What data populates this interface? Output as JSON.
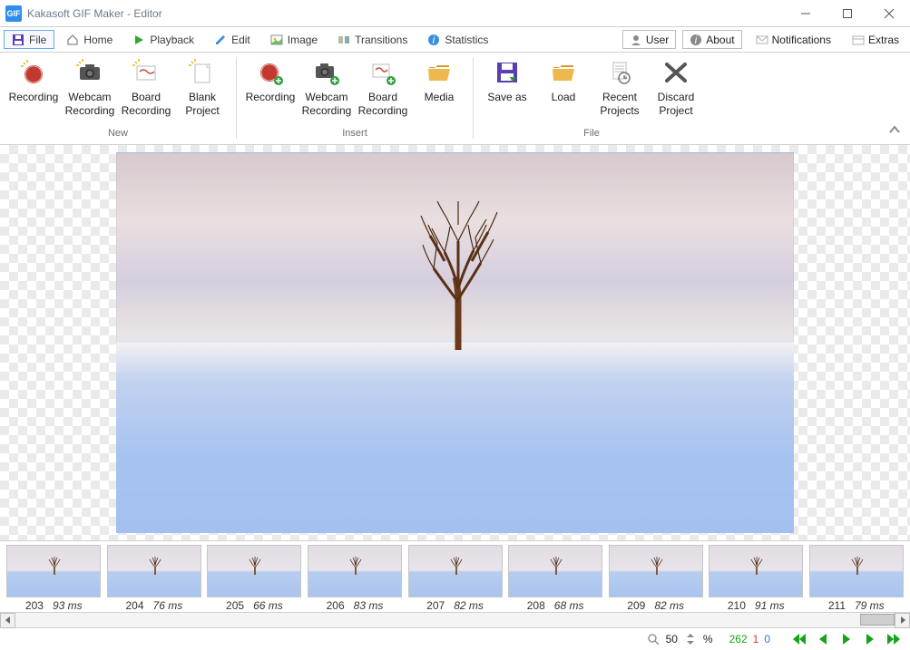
{
  "window": {
    "title": "Kakasoft GIF Maker - Editor",
    "logo": "GIF"
  },
  "tabs": {
    "file": "File",
    "home": "Home",
    "playback": "Playback",
    "edit": "Edit",
    "image": "Image",
    "transitions": "Transitions",
    "statistics": "Statistics"
  },
  "topright": {
    "user": "User",
    "about": "About",
    "notifications": "Notifications",
    "extras": "Extras"
  },
  "ribbon": {
    "groups": {
      "new": {
        "label": "New",
        "items": [
          {
            "key": "recording",
            "label": "Recording"
          },
          {
            "key": "webcam",
            "label": "Webcam\nRecording"
          },
          {
            "key": "board",
            "label": "Board\nRecording"
          },
          {
            "key": "blank",
            "label": "Blank\nProject"
          }
        ]
      },
      "insert": {
        "label": "Insert",
        "items": [
          {
            "key": "irecording",
            "label": "Recording"
          },
          {
            "key": "iwebcam",
            "label": "Webcam\nRecording"
          },
          {
            "key": "iboard",
            "label": "Board\nRecording"
          },
          {
            "key": "media",
            "label": "Media"
          }
        ]
      },
      "file": {
        "label": "File",
        "items": [
          {
            "key": "saveas",
            "label": "Save as"
          },
          {
            "key": "load",
            "label": "Load"
          },
          {
            "key": "recent",
            "label": "Recent\nProjects"
          },
          {
            "key": "discard",
            "label": "Discard\nProject"
          }
        ]
      }
    }
  },
  "frames": [
    {
      "n": "203",
      "ms": "93 ms"
    },
    {
      "n": "204",
      "ms": "76 ms"
    },
    {
      "n": "205",
      "ms": "66 ms"
    },
    {
      "n": "206",
      "ms": "83 ms"
    },
    {
      "n": "207",
      "ms": "82 ms"
    },
    {
      "n": "208",
      "ms": "68 ms"
    },
    {
      "n": "209",
      "ms": "82 ms"
    },
    {
      "n": "210",
      "ms": "91 ms"
    },
    {
      "n": "211",
      "ms": "79 ms"
    }
  ],
  "status": {
    "zoom": "50",
    "pct": "%",
    "total": "262",
    "sel": "1",
    "cur": "0"
  }
}
